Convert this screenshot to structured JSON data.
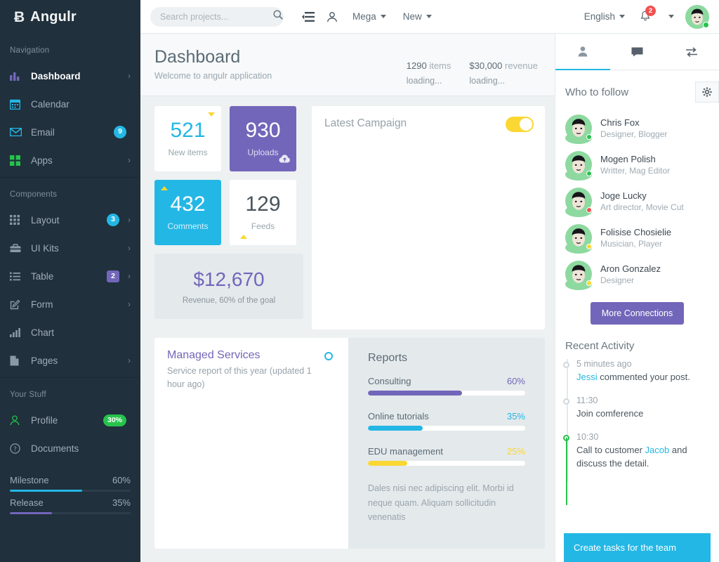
{
  "brand": {
    "mark": "Ƀ",
    "name": "Angulr"
  },
  "sidebar": {
    "sections": [
      {
        "title": "Navigation",
        "items": [
          {
            "label": "Dashboard",
            "icon": "bar-chart-icon",
            "chevron": "›",
            "active": true
          },
          {
            "label": "Calendar",
            "icon": "calendar-icon",
            "chevron": ""
          },
          {
            "label": "Email",
            "icon": "envelope-icon",
            "badge": "9",
            "badge_color": "#23b7e5",
            "badge_shape": "round"
          },
          {
            "label": "Apps",
            "icon": "grid-icon",
            "chevron": "›"
          }
        ]
      },
      {
        "title": "Components",
        "items": [
          {
            "label": "Layout",
            "icon": "layout-grid-icon",
            "badge": "3",
            "badge_color": "#23b7e5",
            "badge_shape": "round",
            "chevron": "›"
          },
          {
            "label": "UI Kits",
            "icon": "briefcase-icon",
            "chevron": "›"
          },
          {
            "label": "Table",
            "icon": "list-icon",
            "badge": "2",
            "badge_color": "#7266ba",
            "badge_shape": "sq",
            "chevron": "›"
          },
          {
            "label": "Form",
            "icon": "edit-icon",
            "chevron": "›"
          },
          {
            "label": "Chart",
            "icon": "chart-bars-icon",
            "chevron": ""
          },
          {
            "label": "Pages",
            "icon": "file-icon",
            "chevron": "›"
          }
        ]
      },
      {
        "title": "Your Stuff",
        "items": [
          {
            "label": "Profile",
            "icon": "user-outline-icon",
            "badge": "30%",
            "badge_color": "#27c24c",
            "badge_shape": "sq"
          },
          {
            "label": "Documents",
            "icon": "question-circle-icon",
            "chevron": ""
          }
        ]
      }
    ],
    "progress": [
      {
        "label": "Milestone",
        "value": "60%",
        "pct": 60,
        "color": "#23b7e5"
      },
      {
        "label": "Release",
        "value": "35%",
        "pct": 35,
        "color": "#7266ba"
      }
    ]
  },
  "topbar": {
    "search_placeholder": "Search projects...",
    "search_value": "",
    "mega_label": "Mega",
    "new_label": "New",
    "language_label": "English",
    "notification_count": "2"
  },
  "page": {
    "title": "Dashboard",
    "subtitle": "Welcome to angulr application",
    "stats": [
      {
        "value": "1290",
        "unit": "items",
        "loading": "loading..."
      },
      {
        "value": "$30,000",
        "unit": "revenue",
        "loading": "loading..."
      }
    ]
  },
  "cards": {
    "new_items": {
      "num": "521",
      "caption": "New items",
      "trend": "down"
    },
    "uploads": {
      "num": "930",
      "caption": "Uploads",
      "icon": "cloud-upload-icon"
    },
    "comments": {
      "num": "432",
      "caption": "Comments",
      "trend": "up"
    },
    "feeds": {
      "num": "129",
      "caption": "Feeds",
      "trend": "up"
    },
    "revenue": {
      "num": "$12,670",
      "caption": "Revenue, 60% of the goal"
    }
  },
  "campaign": {
    "title": "Latest Campaign",
    "toggle_on": true
  },
  "managed": {
    "title": "Managed Services",
    "subtitle": "Service report of this year (updated 1 hour ago)"
  },
  "reports": {
    "title": "Reports",
    "rows": [
      {
        "label": "Consulting",
        "value": "60%",
        "pct": 60,
        "color": "#7266ba"
      },
      {
        "label": "Online tutorials",
        "value": "35%",
        "pct": 35,
        "color": "#23b7e5"
      },
      {
        "label": "EDU management",
        "value": "25%",
        "pct": 25,
        "color": "#fad733"
      }
    ],
    "note": "Dales nisi nec adipiscing elit. Morbi id neque quam. Aliquam sollicitudin venenatis"
  },
  "right": {
    "tabs": [
      {
        "icon": "user-icon",
        "active": true
      },
      {
        "icon": "chat-bubble-icon",
        "active": false
      },
      {
        "icon": "transfer-arrows-icon",
        "active": false
      }
    ],
    "follow_title": "Who to follow",
    "gear_icon": "gear-icon",
    "people": [
      {
        "name": "Chris Fox",
        "role": "Designer, Blogger",
        "status": "#27c24c"
      },
      {
        "name": "Mogen Polish",
        "role": "Writter, Mag Editor",
        "status": "#27c24c"
      },
      {
        "name": "Joge Lucky",
        "role": "Art director, Movie Cut",
        "status": "#f05050"
      },
      {
        "name": "Folisise Chosielie",
        "role": "Musician, Player",
        "status": "#fad733"
      },
      {
        "name": "Aron Gonzalez",
        "role": "Designer",
        "status": "#fad733"
      }
    ],
    "more_label": "More Connections",
    "activity_title": "Recent Activity",
    "activities": [
      {
        "time": "5 minutes ago",
        "link": "Jessi",
        "text_after": " commented your post.",
        "text_before": "",
        "highlight": false
      },
      {
        "time": "11:30",
        "link": "",
        "text_before": "Join comference",
        "text_after": "",
        "highlight": false
      },
      {
        "time": "10:30",
        "text_before": "Call to customer ",
        "link": "Jacob",
        "text_after": " and discuss the detail.",
        "highlight": true
      }
    ],
    "cta_label": "Create tasks for the team"
  }
}
